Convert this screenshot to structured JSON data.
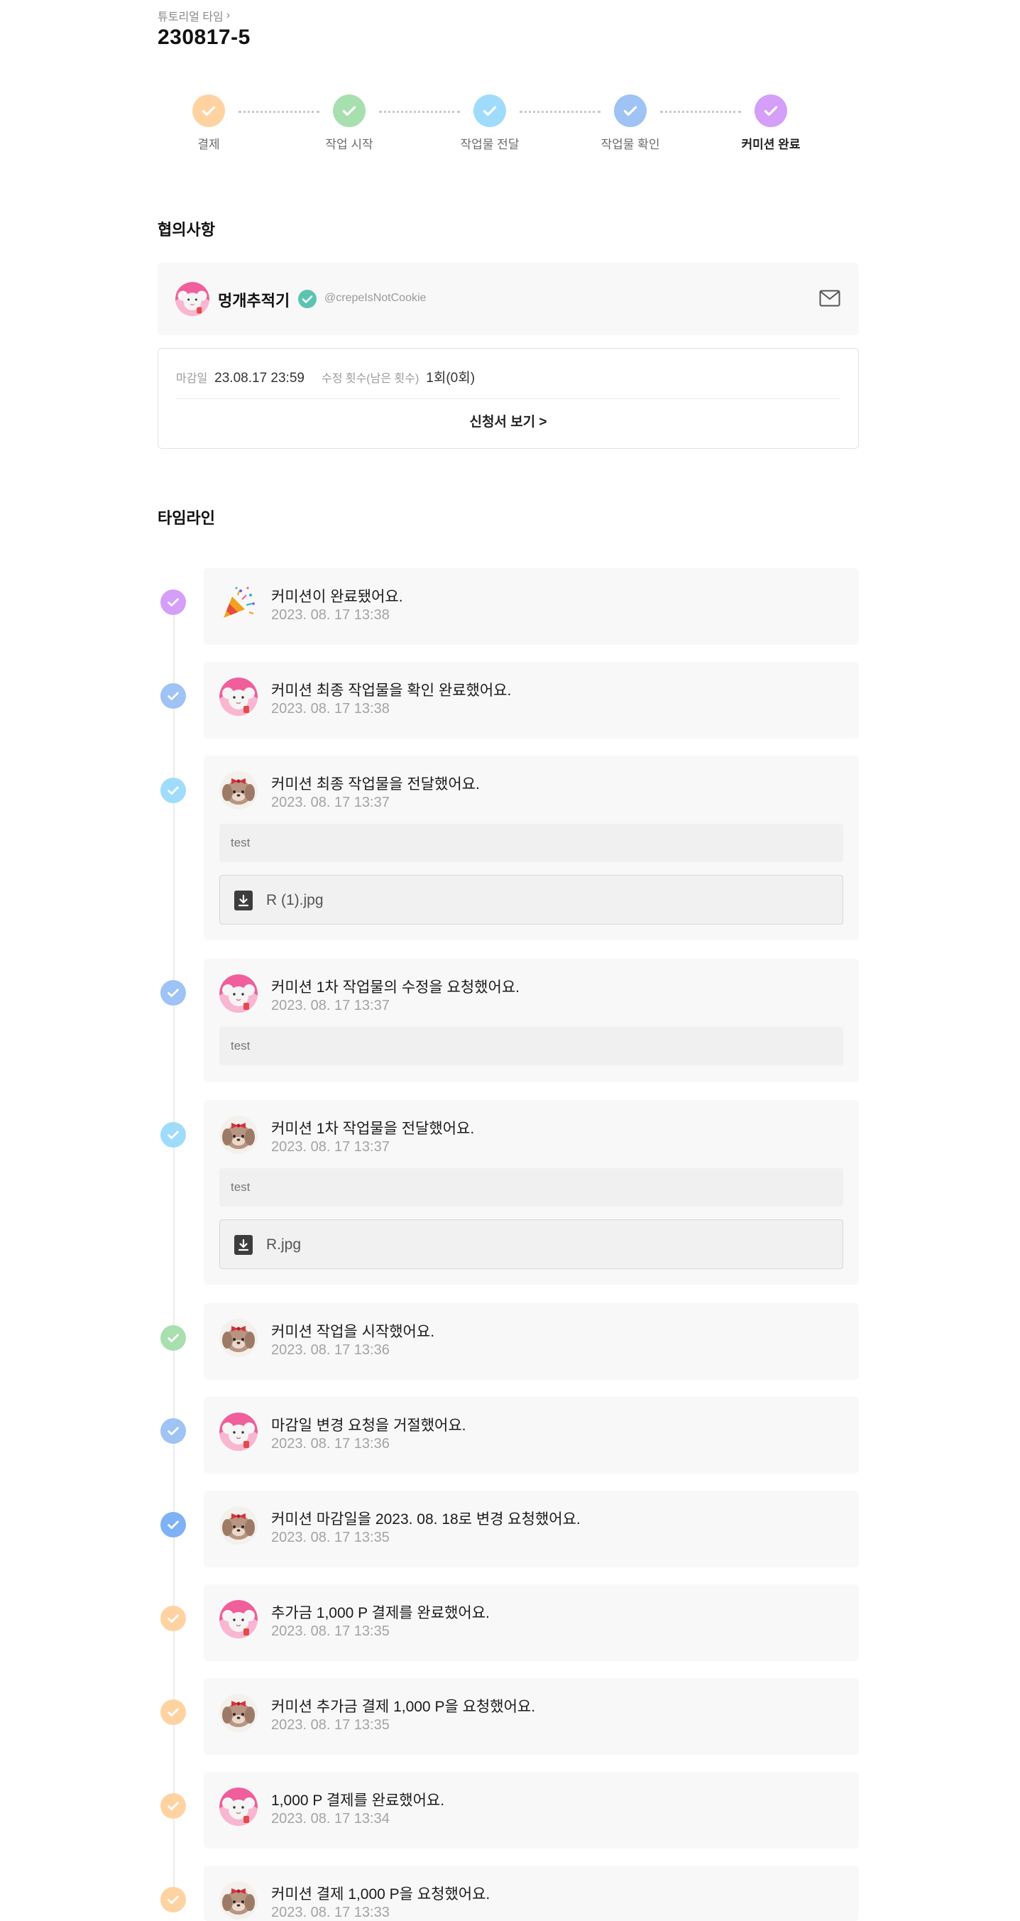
{
  "breadcrumb": {
    "label": "튜토리얼 타임",
    "chevron": "›"
  },
  "page_title": "230817-5",
  "colors": {
    "orange": "#ffd3a1",
    "green": "#a8dfae",
    "skyblue": "#9fdcfb",
    "blue": "#9ec3f4",
    "blue_strong": "#7eb2f6",
    "purple": "#d59ef9"
  },
  "stepper": [
    {
      "label": "결제",
      "color": "#ffd3a1",
      "active": false
    },
    {
      "label": "작업 시작",
      "color": "#a8dfae",
      "active": false
    },
    {
      "label": "작업물 전달",
      "color": "#9fdcfb",
      "active": false
    },
    {
      "label": "작업물 확인",
      "color": "#9ec3f4",
      "active": false
    },
    {
      "label": "커미션 완료",
      "color": "#d59ef9",
      "active": true
    }
  ],
  "agreement": {
    "section_title": "협의사항",
    "artist": {
      "name": "멍개추적기",
      "handle": "@crepeIsNotCookie",
      "verified_icon": "check-badge-icon",
      "mail_icon": "mail-icon"
    },
    "deadline_key": "마감일",
    "deadline_value": "23.08.17 23:59",
    "revisions_key": "수정 횟수(남은 횟수)",
    "revisions_value": "1회(0회)",
    "view_application": "신청서 보기 >"
  },
  "timeline": {
    "section_title": "타임라인",
    "events": [
      {
        "dot": "#d59ef9",
        "avatar": "party-popper-icon",
        "title": "커미션이 완료됐어요.",
        "time": "2023. 08. 17 13:38"
      },
      {
        "dot": "#9ec3f4",
        "avatar": "client",
        "title": "커미션 최종 작업물을 확인 완료했어요.",
        "time": "2023. 08. 17 13:38"
      },
      {
        "dot": "#9fdcfb",
        "avatar": "artist",
        "title": "커미션 최종 작업물을 전달했어요.",
        "time": "2023. 08. 17 13:37",
        "note": "test",
        "file": "R (1).jpg"
      },
      {
        "dot": "#9ec3f4",
        "avatar": "client",
        "title": "커미션 1차 작업물의 수정을 요청했어요.",
        "time": "2023. 08. 17 13:37",
        "note": "test"
      },
      {
        "dot": "#9fdcfb",
        "avatar": "artist",
        "title": "커미션 1차 작업물을 전달했어요.",
        "time": "2023. 08. 17 13:37",
        "note": "test",
        "file": "R.jpg"
      },
      {
        "dot": "#a8dfae",
        "avatar": "artist",
        "title": "커미션 작업을 시작했어요.",
        "time": "2023. 08. 17 13:36"
      },
      {
        "dot": "#9ec3f4",
        "avatar": "client",
        "title": "마감일 변경 요청을 거절했어요.",
        "time": "2023. 08. 17 13:36"
      },
      {
        "dot": "#7eb2f6",
        "avatar": "artist",
        "title": "커미션 마감일을 2023. 08. 18로 변경 요청했어요.",
        "time": "2023. 08. 17 13:35"
      },
      {
        "dot": "#ffd3a1",
        "avatar": "client",
        "title": "추가금 1,000 P 결제를 완료했어요.",
        "time": "2023. 08. 17 13:35"
      },
      {
        "dot": "#ffd3a1",
        "avatar": "artist",
        "title": "커미션 추가금 결제 1,000 P을 요청했어요.",
        "time": "2023. 08. 17 13:35"
      },
      {
        "dot": "#ffd3a1",
        "avatar": "client",
        "title": "1,000 P 결제를 완료했어요.",
        "time": "2023. 08. 17 13:34"
      },
      {
        "dot": "#ffd3a1",
        "avatar": "artist",
        "title": "커미션 결제 1,000 P을 요청했어요.",
        "time": "2023. 08. 17 13:33"
      }
    ]
  }
}
